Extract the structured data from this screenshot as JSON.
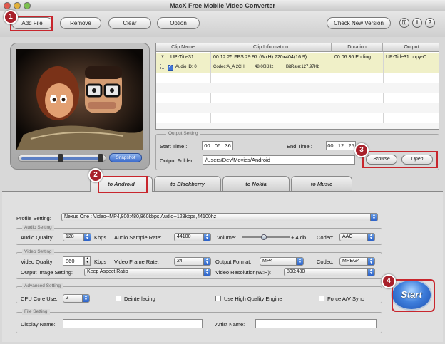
{
  "window": {
    "title": "MacX Free Mobile Video Converter"
  },
  "toolbar": {
    "add_file": "Add File",
    "remove": "Remove",
    "clear": "Clear",
    "option": "Option",
    "check_new_version": "Check New Version",
    "lock_icon": "⚿",
    "info_icon": "i",
    "help_icon": "?"
  },
  "callouts": [
    "1",
    "2",
    "3",
    "4"
  ],
  "preview": {
    "snapshot": "Snapshot"
  },
  "clip_table": {
    "headers": [
      "Clip Name",
      "Clip Information",
      "Duration",
      "Output"
    ],
    "row": {
      "name": "UP-Title31",
      "info": "00:12:25  FPS:29.97  (WxH):720x404(16:9)",
      "duration": "00:06:36 Ending",
      "output": "UP-Title31 copy-C"
    },
    "audio": {
      "label": "Audio ID: 0",
      "codec": "Codec:A_A 2CH",
      "rate": "48.00KHz",
      "bitrate": "BitRate:127.97Kb"
    }
  },
  "output_setting": {
    "legend": "Output Setting",
    "start_time_label": "Start Time :",
    "start_time": "00 : 06 : 36",
    "end_time_label": "End Time :",
    "end_time": "00 : 12 : 25",
    "folder_label": "Output Folder :",
    "folder": "/Users/Dev/Movies/Android",
    "browse": "Browse",
    "open": "Open"
  },
  "tabs": [
    "to Android",
    "to Blackberry",
    "to Nokia",
    "to Music"
  ],
  "profile": {
    "label": "Profile Setting:",
    "value": "Nexus One : Video--MP4,800:480,860kbps,Audio--128kbps,44100hz"
  },
  "audio_setting": {
    "legend": "Audio Setting",
    "quality_label": "Audio Quality:",
    "quality": "128",
    "kbps": "Kbps",
    "sample_rate_label": "Audio Sample Rate:",
    "sample_rate": "44100",
    "volume_label": "Volume:",
    "volume_value": "+ 4 db.",
    "volume_level": 0.45,
    "codec_label": "Codec:",
    "codec": "AAC"
  },
  "video_setting": {
    "legend": "Video Setting",
    "quality_label": "Video Quality:",
    "quality": "860",
    "kbps": "Kbps",
    "frame_rate_label": "Video Frame Rate:",
    "frame_rate": "24",
    "format_label": "Output Format:",
    "format": "MP4",
    "codec_label": "Codec:",
    "codec": "MPEG4",
    "image_label": "Output Image Setting:",
    "image": "Keep Aspect Ratio",
    "resolution_label": "Video Resolution(W:H):",
    "resolution": "800:480"
  },
  "advanced_setting": {
    "legend": "Advanced Setting",
    "cpu_label": "CPU Core Use:",
    "cpu": "2",
    "deinterlacing": "Deinterlacing",
    "high_quality": "Use High Quality Engine",
    "force_sync": "Force A/V Sync"
  },
  "file_setting": {
    "legend": "File Setting",
    "display_name_label": "Display Name:",
    "display_name": "",
    "artist_name_label": "Artist Name:",
    "artist_name": ""
  },
  "start_button": "Start",
  "colors": {
    "callout_red": "#c8262d",
    "selected_row": "#f0f0c8",
    "accent_blue": "#2d62c8"
  }
}
